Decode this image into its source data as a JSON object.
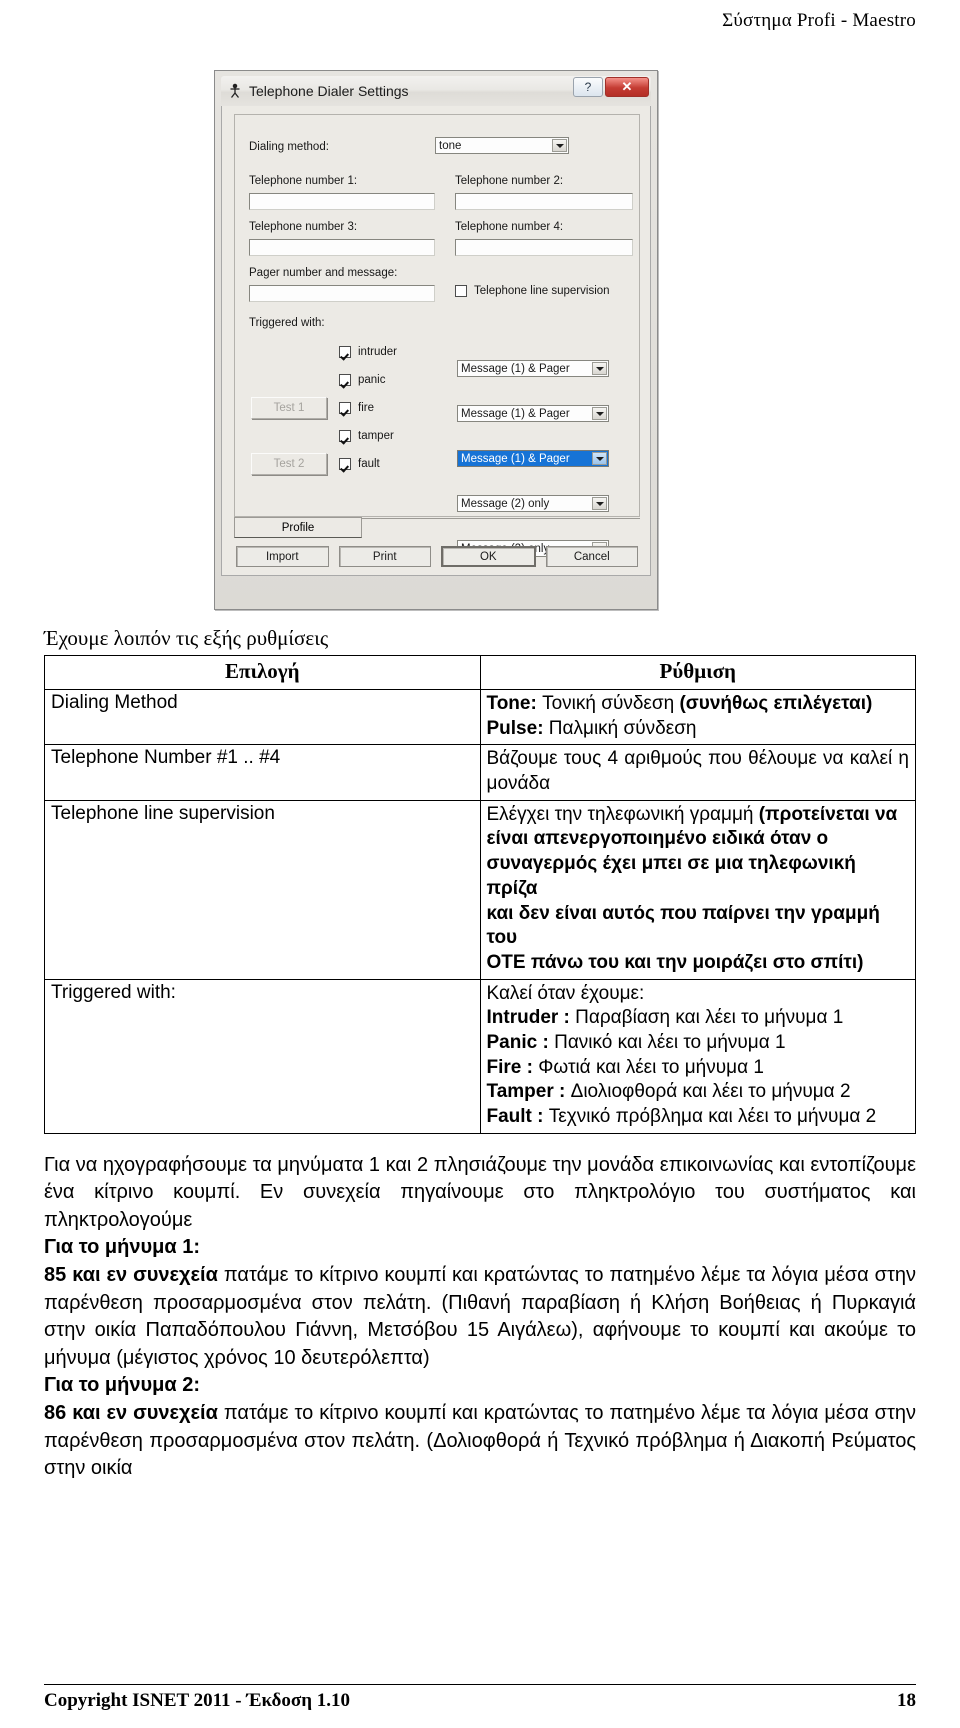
{
  "header": {
    "title": "Σύστημα Profi - Maestro"
  },
  "dialog": {
    "title": "Telephone Dialer Settings",
    "help_button": "?",
    "close_button": "✕",
    "dialing_method_label": "Dialing method:",
    "dialing_method_value": "tone",
    "phone_labels": [
      "Telephone number 1:",
      "Telephone number 2:",
      "Telephone number 3:",
      "Telephone number 4:"
    ],
    "phone_values": [
      "",
      "",
      "",
      ""
    ],
    "pager_label": "Pager number and message:",
    "pager_value": "",
    "line_supervision_label": "Telephone line supervision",
    "line_supervision_checked": false,
    "triggered_with_label": "Triggered with:",
    "triggers": [
      {
        "name": "intruder",
        "checked": true,
        "action": "Message (1) & Pager",
        "selected": false
      },
      {
        "name": "panic",
        "checked": true,
        "action": "Message (1) & Pager",
        "selected": false
      },
      {
        "name": "fire",
        "checked": true,
        "action": "Message (1) & Pager",
        "selected": true
      },
      {
        "name": "tamper",
        "checked": true,
        "action": "Message (2) only",
        "selected": false
      },
      {
        "name": "fault",
        "checked": true,
        "action": "Message (2) only",
        "selected": false
      }
    ],
    "test1_label": "Test 1",
    "test2_label": "Test 2",
    "profile_tab_label": "Profile",
    "buttons": [
      "Import",
      "Print",
      "OK",
      "Cancel"
    ],
    "accent_selected_color": "#1673d6",
    "close_button_color": "#c43c33"
  },
  "intro_line": "Έχουμε λοιπόν τις εξής ρυθμίσεις",
  "table": {
    "headers": [
      "Επιλογή",
      "Ρύθμιση"
    ],
    "rows": [
      {
        "key": "Dialing Method",
        "lines": [
          {
            "bold": "Tone:",
            "rest": " Τονική σύνδεση ",
            "bold_tail": "(συνήθως επιλέγεται)"
          },
          {
            "bold": "Pulse:",
            "rest": " Παλμική σύνδεση",
            "bold_tail": ""
          }
        ]
      },
      {
        "key": "Telephone Number #1 .. #4",
        "justified": "Βάζουμε τους 4 αριθμούς που θέλουμε να καλεί η μονάδα"
      },
      {
        "key": "Telephone line supervision",
        "lines": [
          {
            "bold": "",
            "rest": "Ελέγχει την τηλεφωνική γραμμή ",
            "bold_tail": "(προτείνεται να"
          },
          {
            "bold": "",
            "rest": "",
            "bold_tail": "είναι απενεργοποιημένο ειδικά όταν ο"
          },
          {
            "bold": "",
            "rest": "",
            "bold_tail": "συναγερμός έχει μπει σε μια τηλεφωνική πρίζα"
          },
          {
            "bold": "",
            "rest": "",
            "bold_tail": "και δεν είναι αυτός που παίρνει την γραμμή του"
          },
          {
            "bold": "",
            "rest": "",
            "bold_tail": "ΟΤΕ πάνω του και την μοιράζει στο σπίτι)"
          }
        ]
      },
      {
        "key": "Triggered with:",
        "lines": [
          {
            "bold": "",
            "rest": "Καλεί όταν έχουμε:",
            "bold_tail": ""
          },
          {
            "bold": "Intruder :",
            "rest": " Παραβίαση και λέει το μήνυμα 1",
            "bold_tail": ""
          },
          {
            "bold": "Panic :",
            "rest": " Πανικό και λέει το μήνυμα 1",
            "bold_tail": ""
          },
          {
            "bold": "Fire :",
            "rest": " Φωτιά και λέει το μήνυμα 1",
            "bold_tail": ""
          },
          {
            "bold": "Tamper :",
            "rest": " Διολιοφθορά και λέει το μήνυμα 2",
            "bold_tail": ""
          },
          {
            "bold": "Fault :",
            "rest": " Τεχνικό πρόβλημα και λέει το μήνυμα 2",
            "bold_tail": ""
          }
        ]
      }
    ]
  },
  "body": {
    "p1": "Για να ηχογραφήσουμε τα μηνύματα 1 και 2 πλησιάζουμε την μονάδα επικοινωνίας και εντοπίζουμε ένα κίτρινο κουμπί. Εν συνεχεία πηγαίνουμε στο πληκτρολόγιο του συστήματος και πληκτρολογούμε",
    "h1": "Για το μήνυμα 1:",
    "p2_bold": "85 και εν συνεχεία",
    "p2_rest": " πατάμε το κίτρινο κουμπί και κρατώντας το πατημένο λέμε τα λόγια μέσα στην παρένθεση προσαρμοσμένα στον πελάτη. (Πιθανή παραβίαση ή Κλήση Βοήθειας ή Πυρκαγιά στην οικία Παπαδόπουλου Γιάννη, Μετσόβου 15 Αιγάλεω), αφήνουμε το κουμπί και ακούμε το μήνυμα (μέγιστος χρόνος 10 δευτερόλεπτα)",
    "h2": "Για το μήνυμα 2:",
    "p3_bold": "86 και εν συνεχεία",
    "p3_rest": " πατάμε το κίτρινο κουμπί και κρατώντας το πατημένο λέμε τα λόγια μέσα στην παρένθεση προσαρμοσμένα στον πελάτη. (Δολιοφθορά ή Τεχνικό πρόβλημα ή Διακοπή Ρεύματος στην οικία"
  },
  "footer": {
    "copyright": "Copyright ISNET 2011 - Έκδοση 1.10",
    "page_number": "18"
  }
}
